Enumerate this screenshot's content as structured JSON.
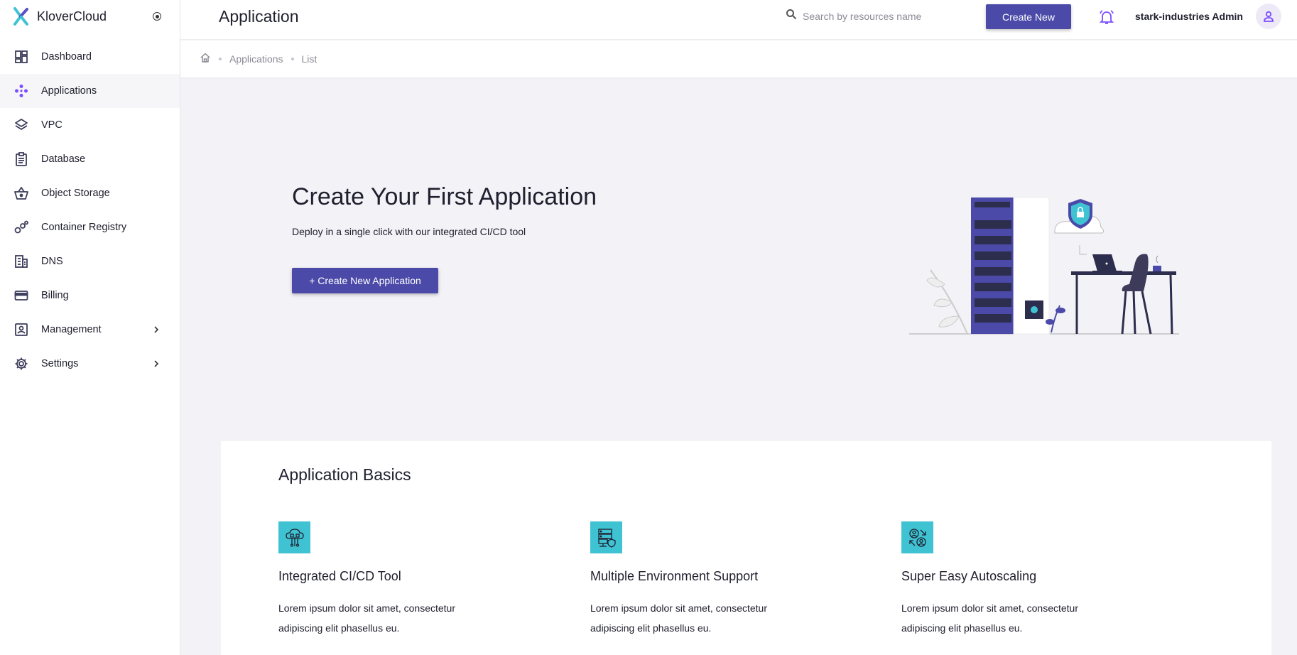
{
  "app": {
    "name": "KloverCloud",
    "accent": "#4b4aa8",
    "icon_accent": "#7c4dff"
  },
  "sidebar": {
    "items": [
      {
        "label": "Dashboard",
        "icon": "dashboard-icon"
      },
      {
        "label": "Applications",
        "icon": "applications-icon",
        "active": true
      },
      {
        "label": "VPC",
        "icon": "layers-icon"
      },
      {
        "label": "Database",
        "icon": "database-icon"
      },
      {
        "label": "Object Storage",
        "icon": "basket-icon"
      },
      {
        "label": "Container Registry",
        "icon": "registry-icon"
      },
      {
        "label": "DNS",
        "icon": "building-icon"
      },
      {
        "label": "Billing",
        "icon": "credit-card-icon"
      },
      {
        "label": "Management",
        "icon": "management-icon",
        "expandable": true
      },
      {
        "label": "Settings",
        "icon": "gear-icon",
        "expandable": true
      }
    ]
  },
  "header": {
    "title": "Application",
    "search_placeholder": "Search by resources name",
    "create_label": "Create New",
    "user": "stark-industries Admin"
  },
  "breadcrumb": {
    "items": [
      "Applications",
      "List"
    ]
  },
  "hero": {
    "title": "Create Your First Application",
    "subtitle": "Deploy in a single click with our integrated CI/CD tool",
    "button_label": "+ Create New Application"
  },
  "basics": {
    "title": "Application Basics",
    "features": [
      {
        "title": "Integrated CI/CD Tool",
        "text": "Lorem ipsum dolor sit amet, consectetur adipiscing elit phasellus eu.",
        "icon": "cloud-cicd-icon"
      },
      {
        "title": "Multiple Environment Support",
        "text": "Lorem ipsum dolor sit amet, consectetur adipiscing elit phasellus eu.",
        "icon": "server-shield-icon"
      },
      {
        "title": "Super Easy Autoscaling",
        "text": "Lorem ipsum dolor sit amet, consectetur adipiscing elit phasellus eu.",
        "icon": "users-scaling-icon"
      }
    ]
  }
}
